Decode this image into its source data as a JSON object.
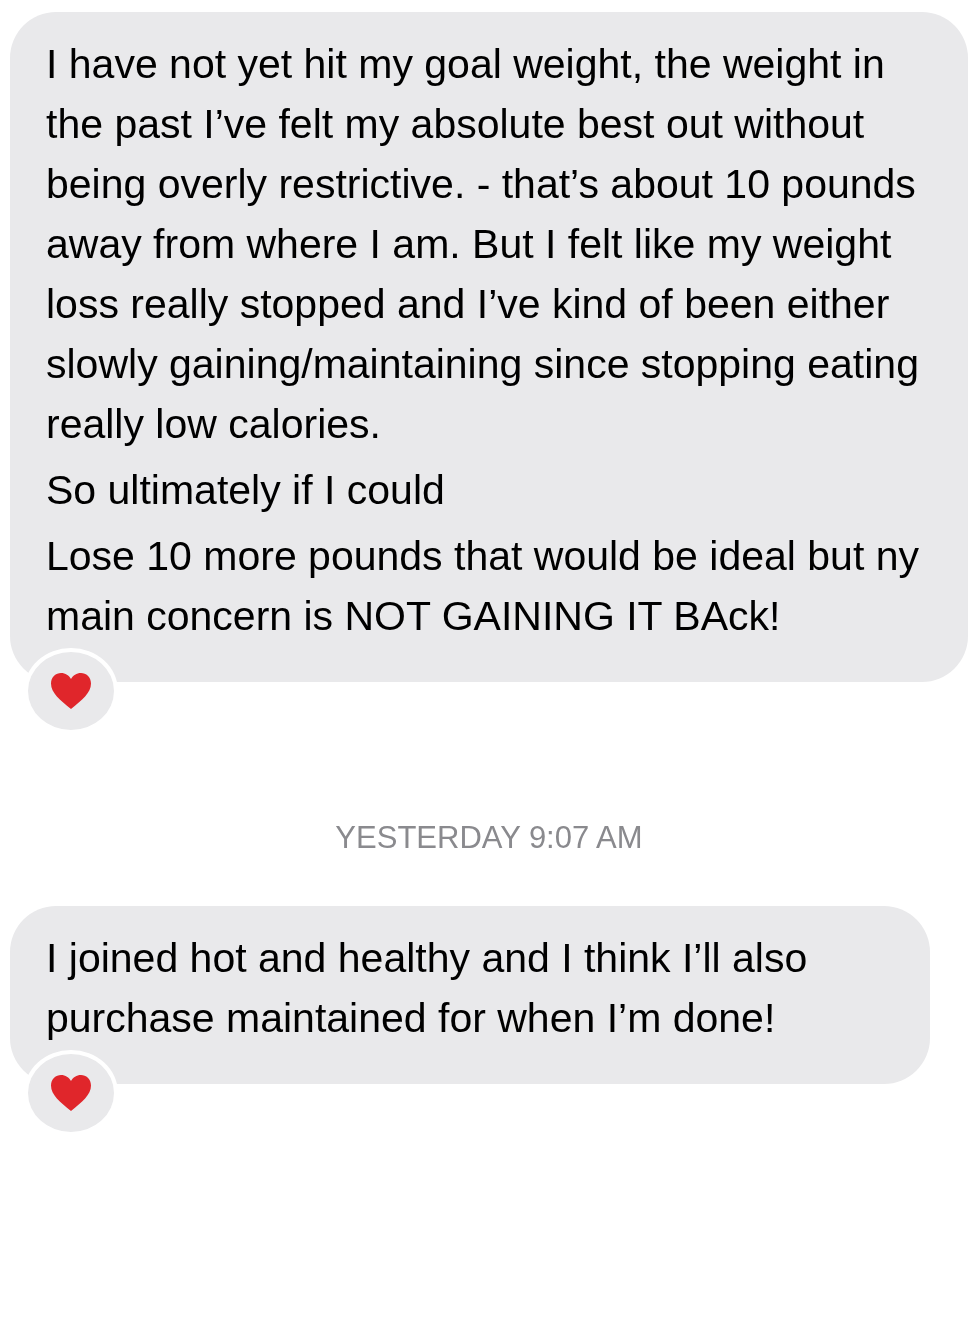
{
  "messages": [
    {
      "paragraphs": [
        "I have not yet hit my goal weight, the weight in the past I’ve felt my absolute best out without being overly restrictive. - that’s about 10 pounds away from where I am. But I felt like my weight loss really stopped and I’ve kind of been either slowly gaining/maintaining since stopping eating really low calories.",
        "So ultimately if I could",
        "Lose 10 more pounds that would be ideal but ny main concern is NOT GAINING IT BAck!"
      ],
      "reacted": true
    },
    {
      "timestamp": "YESTERDAY 9:07 AM",
      "paragraphs": [
        "I joined hot and healthy and I think I’ll also purchase maintained for when I’m done!"
      ],
      "reacted": true
    }
  ]
}
